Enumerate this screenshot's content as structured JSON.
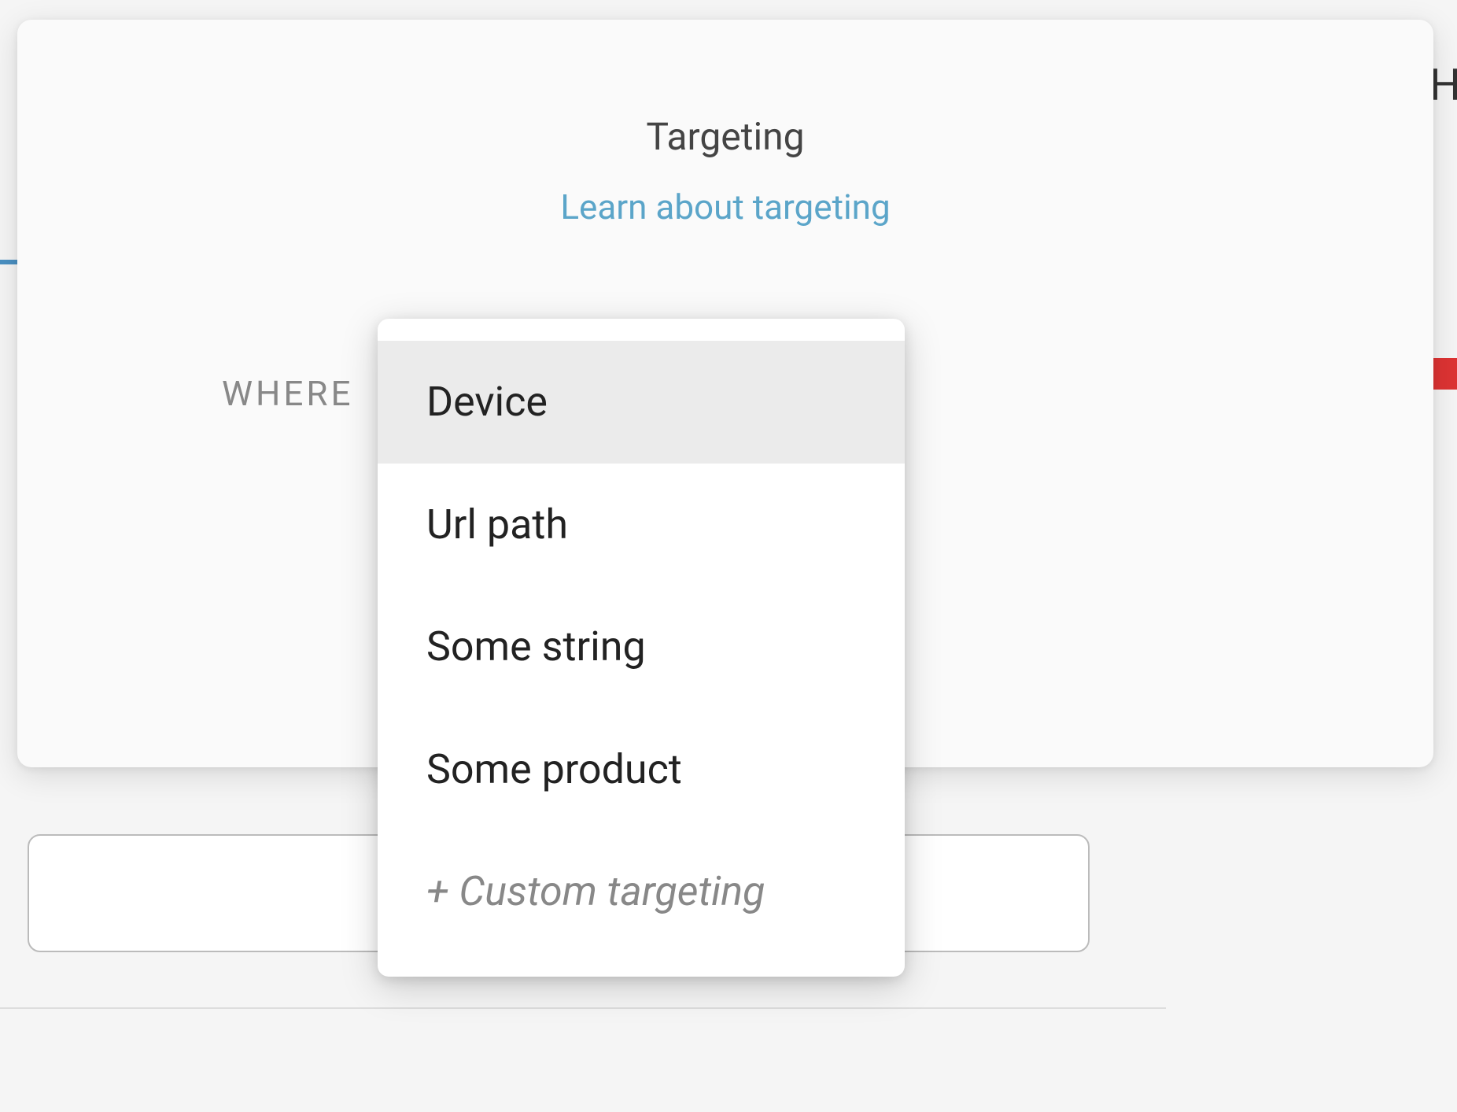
{
  "panel": {
    "title": "Targeting",
    "learn_link": "Learn about targeting",
    "where_label": "WHERE"
  },
  "dropdown": {
    "items": [
      {
        "label": "Device",
        "highlighted": true,
        "custom": false
      },
      {
        "label": "Url path",
        "highlighted": false,
        "custom": false
      },
      {
        "label": "Some string",
        "highlighted": false,
        "custom": false
      },
      {
        "label": "Some product",
        "highlighted": false,
        "custom": false
      },
      {
        "label": "+ Custom targeting",
        "highlighted": false,
        "custom": true
      }
    ]
  },
  "background": {
    "right_letter": "H"
  },
  "colors": {
    "link": "#5ba5c9",
    "text": "#444",
    "muted": "#888",
    "highlight_bg": "#ebebeb"
  }
}
